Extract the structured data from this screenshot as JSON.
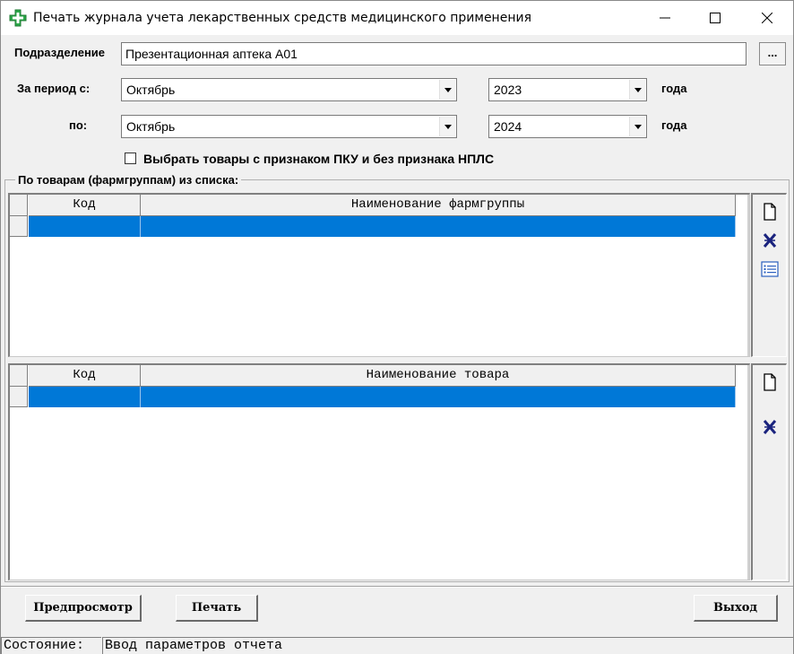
{
  "window": {
    "title": "Печать журнала учета лекарственных средств медицинского применения",
    "icon": "green-cross-icon"
  },
  "form": {
    "department_label": "Подразделение",
    "department_value": "Презентационная аптека А01",
    "browse_label": "...",
    "period_from_label": "За период с:",
    "month_from": "Октябрь",
    "year_from": "2023",
    "year_suffix_from": "года",
    "period_to_label": "по:",
    "month_to": "Октябрь",
    "year_to": "2024",
    "year_suffix_to": "года",
    "checkbox_label": "Выбрать товары с признаком ПКУ и без признака НПЛС",
    "checkbox_checked": false
  },
  "group": {
    "caption": "По товарам (фармгруппам) из списка:"
  },
  "grid_groups": {
    "columns": [
      "Код",
      "Наименование фармгруппы"
    ]
  },
  "grid_items": {
    "columns": [
      "Код",
      "Наименование товара"
    ]
  },
  "buttons": {
    "preview": "Предпросмотр",
    "print": "Печать",
    "exit": "Выход"
  },
  "status": {
    "label": "Состояние:",
    "text": "Ввод параметров отчета"
  },
  "colors": {
    "selection": "#0078d7",
    "icon_green": "#2da84a",
    "icon_navy": "#1a237e"
  }
}
